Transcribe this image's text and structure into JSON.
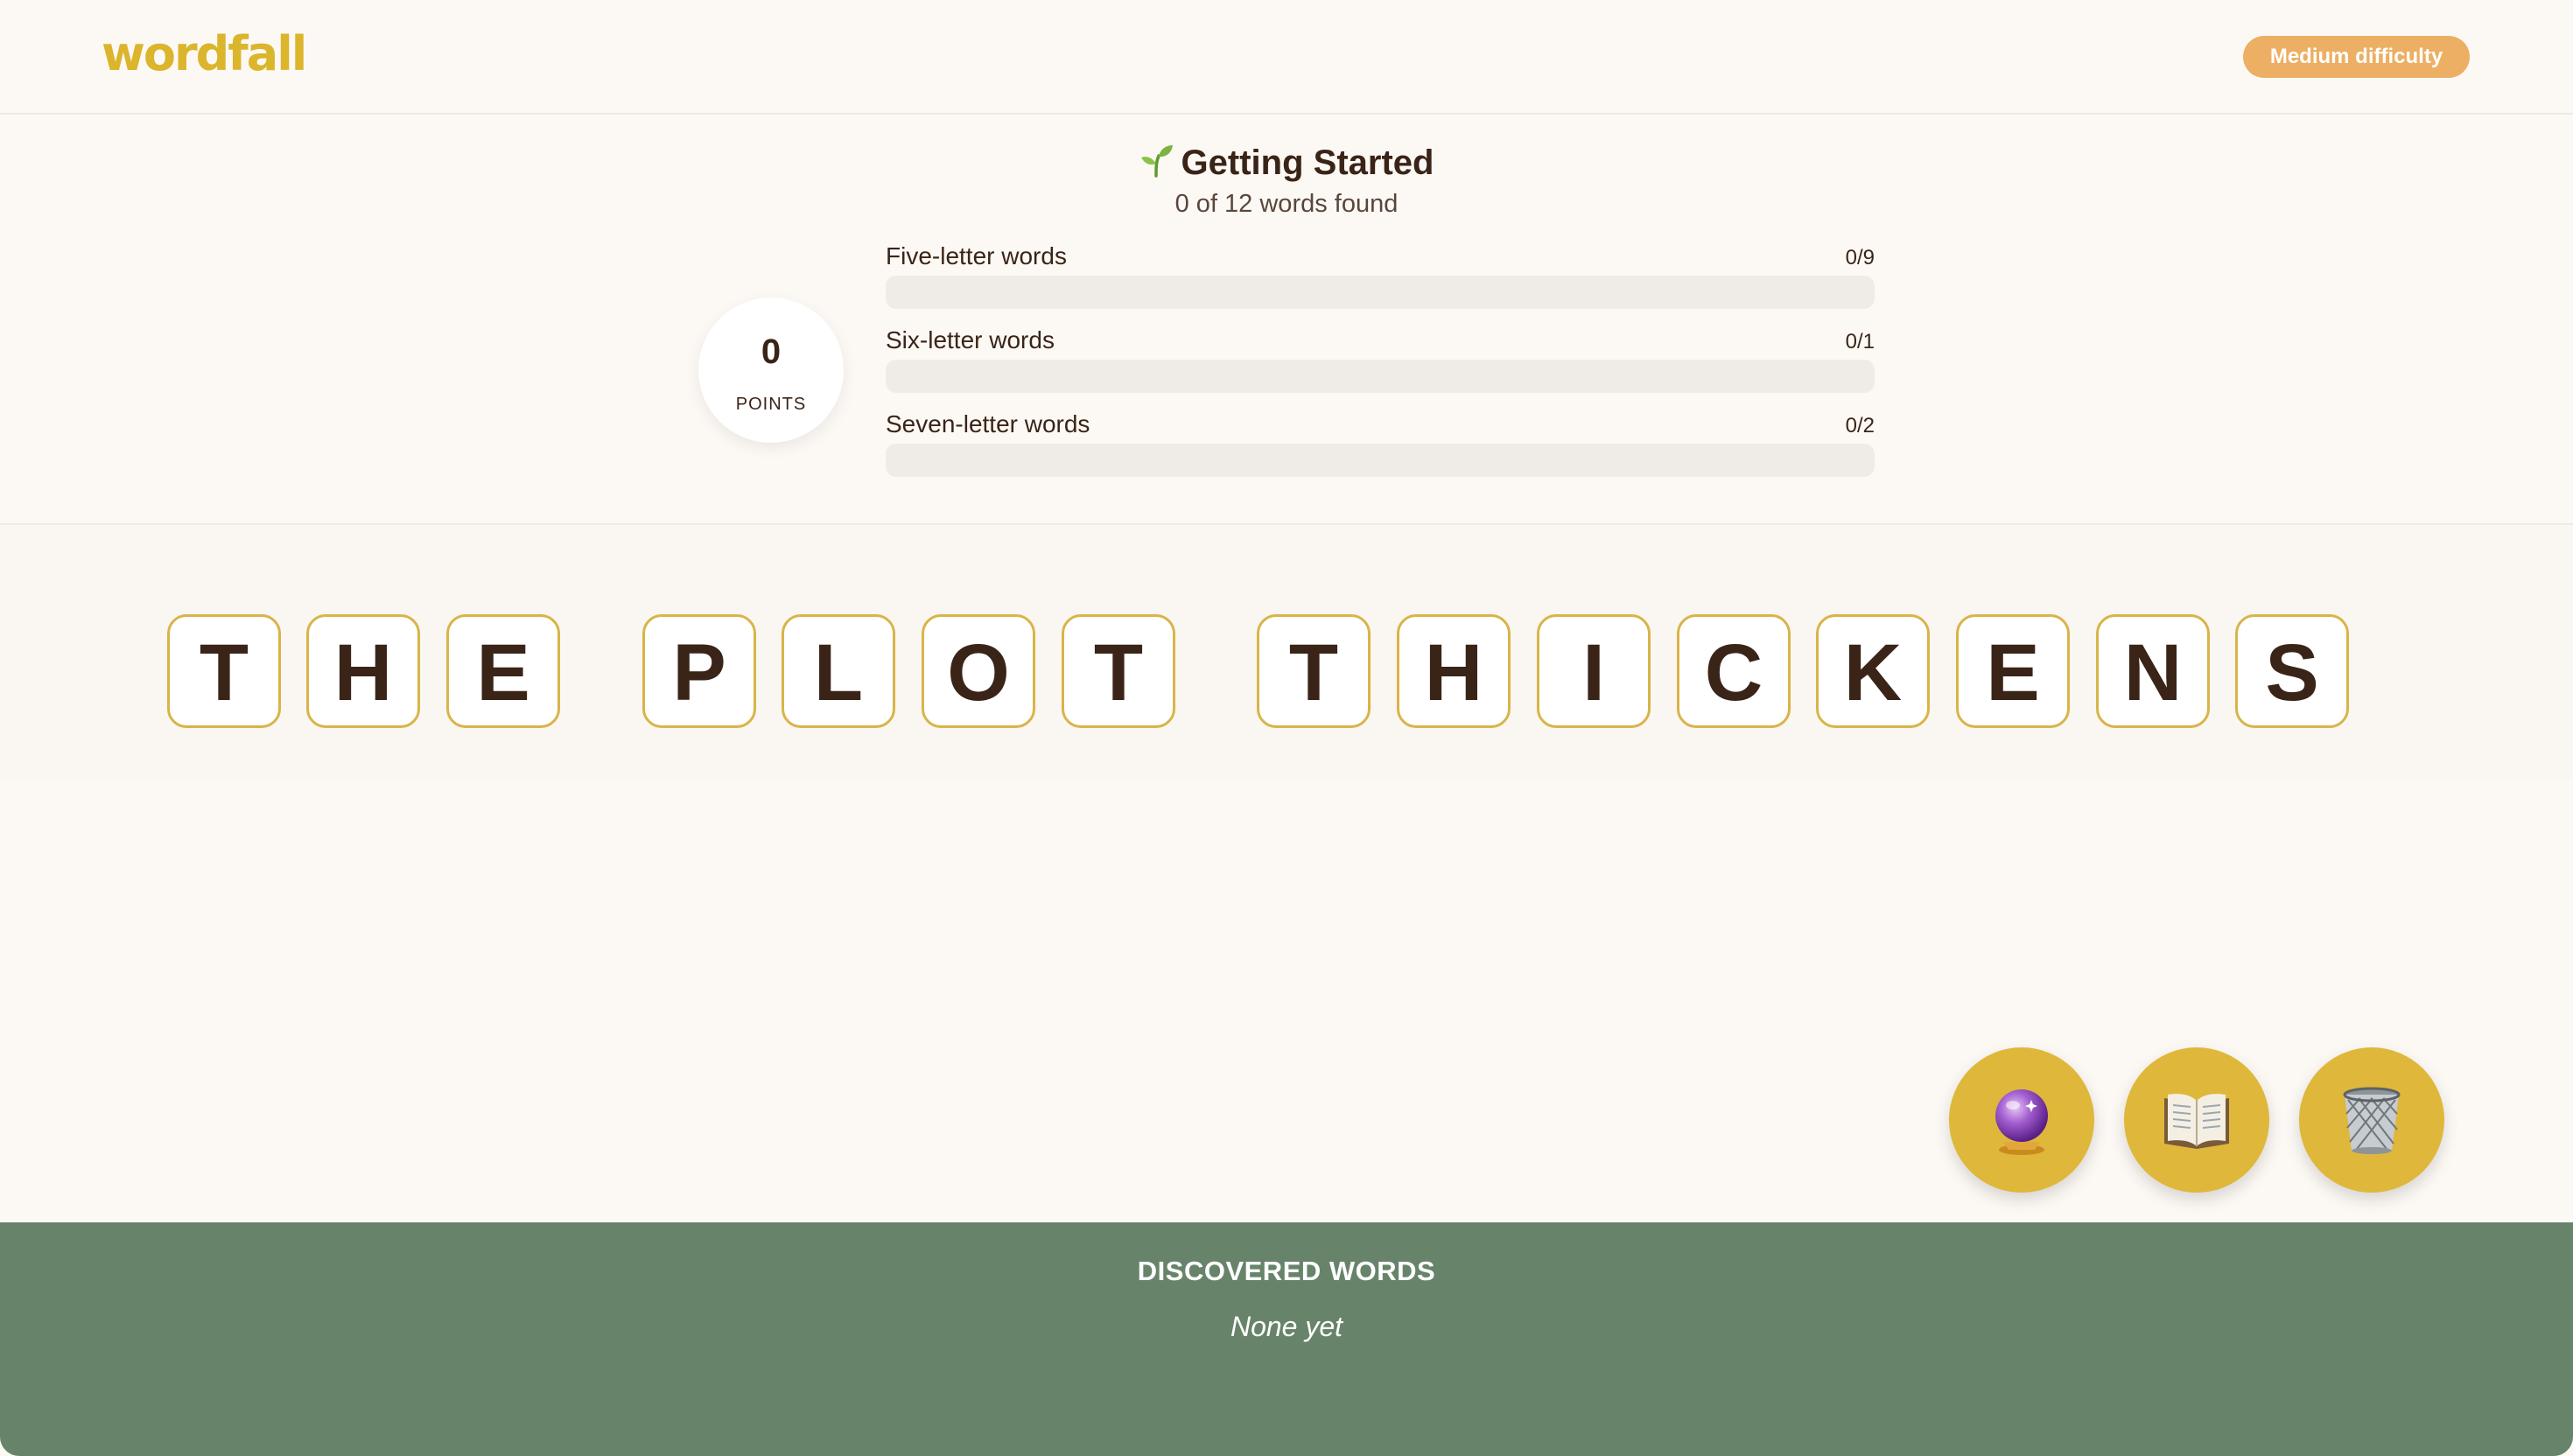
{
  "app": {
    "logo": "wordfall",
    "difficulty": "Medium difficulty"
  },
  "progress": {
    "rank": "Getting Started",
    "rank_icon": "sprout-icon",
    "found_text": "0 of 12 words found",
    "points": {
      "value": "0",
      "label": "POINTS"
    },
    "categories": [
      {
        "label": "Five-letter words",
        "count": "0/9",
        "fraction": 0
      },
      {
        "label": "Six-letter words",
        "count": "0/1",
        "fraction": 0
      },
      {
        "label": "Seven-letter words",
        "count": "0/2",
        "fraction": 0
      }
    ]
  },
  "puzzle": {
    "phrase": "THE PLOT THICKENS",
    "tiles": [
      "T",
      "H",
      "E",
      "P",
      "L",
      "O",
      "T",
      "T",
      "H",
      "I",
      "C",
      "K",
      "E",
      "N",
      "S"
    ]
  },
  "actions": [
    {
      "name": "hint-button",
      "icon": "crystal-ball-icon"
    },
    {
      "name": "dictionary-button",
      "icon": "open-book-icon"
    },
    {
      "name": "clear-button",
      "icon": "wastebasket-icon"
    }
  ],
  "discovered": {
    "title": "DISCOVERED WORDS",
    "empty_text": "None yet"
  },
  "colors": {
    "accent": "#dbb52c",
    "badge": "#ecaf63",
    "tile_border": "#d9b449",
    "footer": "#67846b",
    "background": "#fcf9f5"
  }
}
